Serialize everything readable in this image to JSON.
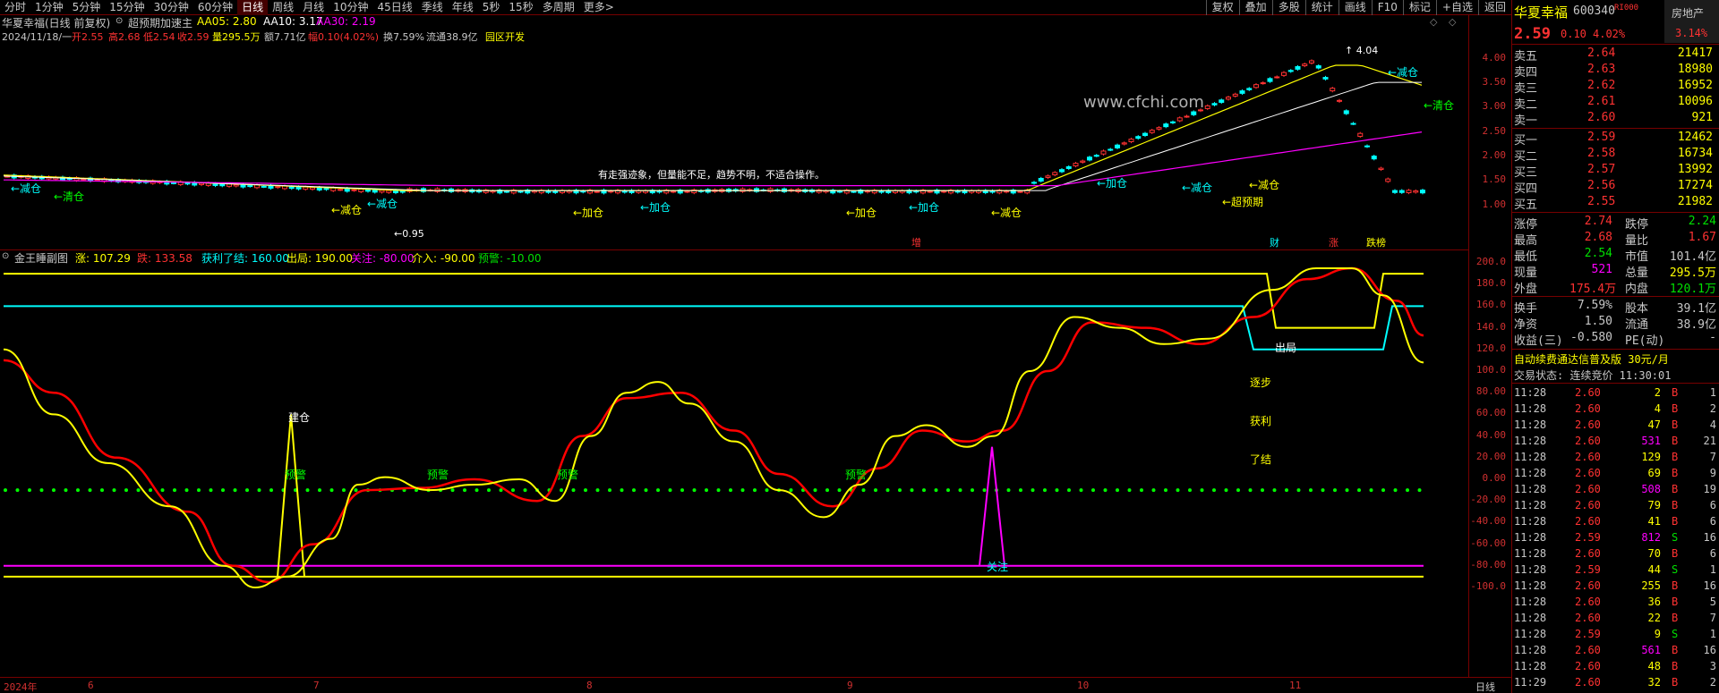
{
  "periods": [
    {
      "label": "分时",
      "active": false
    },
    {
      "label": "1分钟",
      "active": false
    },
    {
      "label": "5分钟",
      "active": false
    },
    {
      "label": "15分钟",
      "active": false
    },
    {
      "label": "30分钟",
      "active": false
    },
    {
      "label": "60分钟",
      "active": false
    },
    {
      "label": "日线",
      "active": true
    },
    {
      "label": "周线",
      "active": false
    },
    {
      "label": "月线",
      "active": false
    },
    {
      "label": "10分钟",
      "active": false
    },
    {
      "label": "45日线",
      "active": false
    },
    {
      "label": "季线",
      "active": false
    },
    {
      "label": "年线",
      "active": false
    },
    {
      "label": "5秒",
      "active": false
    },
    {
      "label": "15秒",
      "active": false
    },
    {
      "label": "多周期",
      "active": false
    },
    {
      "label": "更多>",
      "active": false
    }
  ],
  "functions": [
    "复权",
    "叠加",
    "多股",
    "统计",
    "画线",
    "F10",
    "标记",
    "+自选",
    "返回"
  ],
  "header": {
    "stock_title": "华夏幸福(日线 前复权)",
    "indicator_name": "超预期加速主",
    "aa05": "AA05: 2.80",
    "aa10": "AA10: 3.17",
    "aa30": "AA30: 2.19",
    "date": "2024/11/18/一",
    "open": "开2.55",
    "high": "高2.68",
    "low": "低2.54",
    "close": "收2.59",
    "volume": "量295.5万",
    "amount": "额7.71亿",
    "change": "幅0.10(4.02%)",
    "turnover": "换7.59%",
    "float_cap": "流通38.9亿",
    "concept": "园区开发"
  },
  "watermark": "www.cfchi.com",
  "note": "有走强迹象，但量能不足，趋势不明，不适合操作。",
  "price_labels": {
    "high_mark": "4.04",
    "low_mark": "0.95",
    "signals": [
      "减仓",
      "清仓",
      "减仓",
      "减仓",
      "加仓",
      "加仓",
      "加仓",
      "加仓",
      "减仓",
      "加仓",
      "超预期",
      "减仓",
      "减仓",
      "清仓",
      "减仓"
    ],
    "events": [
      "增",
      "财",
      "涨",
      "跌榜"
    ]
  },
  "sub_header": {
    "name": "金王睡副图",
    "up": "涨: 107.29",
    "down": "跌: 133.58",
    "profit_exit": "获利了结: 160.00",
    "out": "出局: 190.00",
    "watch": "关注: -80.00",
    "enter": "介入: -90.00",
    "warn": "预警: -10.00"
  },
  "sub_labels": {
    "build": "建仓",
    "warn": "预警",
    "watch": "关注",
    "out": "出局",
    "step1": "逐步",
    "step2": "获利",
    "step3": "了结"
  },
  "y_axis_main": [
    "4.00",
    "3.50",
    "3.00",
    "2.50",
    "2.00",
    "1.50",
    "1.00"
  ],
  "y_axis_sub": [
    "200.0",
    "180.0",
    "160.0",
    "140.0",
    "120.0",
    "100.0",
    "80.00",
    "60.00",
    "40.00",
    "20.00",
    "0.00",
    "-20.00",
    "-40.00",
    "-60.00",
    "-80.00",
    "-100.0"
  ],
  "date_axis": [
    "2024年",
    "6",
    "7",
    "8",
    "9",
    "10",
    "11"
  ],
  "period_label": "日线",
  "panel": {
    "name": "华夏幸福",
    "code": "600340",
    "badge": "RI000",
    "sector": "房地产",
    "price": "2.59",
    "chg": "0.10",
    "pct": "4.02%",
    "sector_pct": "3.14%",
    "asks": [
      {
        "label": "卖五",
        "price": "2.64",
        "vol": "21417"
      },
      {
        "label": "卖四",
        "price": "2.63",
        "vol": "18980"
      },
      {
        "label": "卖三",
        "price": "2.62",
        "vol": "16952"
      },
      {
        "label": "卖二",
        "price": "2.61",
        "vol": "10096"
      },
      {
        "label": "卖一",
        "price": "2.60",
        "vol": "921"
      }
    ],
    "bids": [
      {
        "label": "买一",
        "price": "2.59",
        "vol": "12462"
      },
      {
        "label": "买二",
        "price": "2.58",
        "vol": "16734"
      },
      {
        "label": "买三",
        "price": "2.57",
        "vol": "13992"
      },
      {
        "label": "买四",
        "price": "2.56",
        "vol": "17274"
      },
      {
        "label": "买五",
        "price": "2.55",
        "vol": "21982"
      }
    ],
    "stats": [
      {
        "l1": "涨停",
        "v1": "2.74",
        "l2": "跌停",
        "v2": "2.24"
      },
      {
        "l1": "最高",
        "v1": "2.68",
        "l2": "量比",
        "v2": "1.67"
      },
      {
        "l1": "最低",
        "v1": "2.54",
        "l2": "市值",
        "v2": "101.4亿"
      },
      {
        "l1": "现量",
        "v1": "521",
        "l2": "总量",
        "v2": "295.5万"
      },
      {
        "l1": "外盘",
        "v1": "175.4万",
        "l2": "内盘",
        "v2": "120.1万"
      }
    ],
    "stats2": [
      {
        "l1": "换手",
        "v1": "7.59%",
        "l2": "股本",
        "v2": "39.1亿"
      },
      {
        "l1": "净资",
        "v1": "1.50",
        "l2": "流通",
        "v2": "38.9亿"
      },
      {
        "l1": "收益(三)",
        "v1": "-0.580",
        "l2": "PE(动)",
        "v2": "-"
      }
    ],
    "ad": "自动续费通达信普及版  30元/月",
    "trade_status": "交易状态: 连续竞价 11:30:01",
    "ticks": [
      {
        "t": "11:28",
        "p": "2.60",
        "v": "2",
        "bs": "B",
        "n": "1"
      },
      {
        "t": "11:28",
        "p": "2.60",
        "v": "4",
        "bs": "B",
        "n": "2"
      },
      {
        "t": "11:28",
        "p": "2.60",
        "v": "47",
        "bs": "B",
        "n": "4"
      },
      {
        "t": "11:28",
        "p": "2.60",
        "v": "531",
        "bs": "B",
        "n": "21"
      },
      {
        "t": "11:28",
        "p": "2.60",
        "v": "129",
        "bs": "B",
        "n": "7"
      },
      {
        "t": "11:28",
        "p": "2.60",
        "v": "69",
        "bs": "B",
        "n": "9"
      },
      {
        "t": "11:28",
        "p": "2.60",
        "v": "508",
        "bs": "B",
        "n": "19"
      },
      {
        "t": "11:28",
        "p": "2.60",
        "v": "79",
        "bs": "B",
        "n": "6"
      },
      {
        "t": "11:28",
        "p": "2.60",
        "v": "41",
        "bs": "B",
        "n": "6"
      },
      {
        "t": "11:28",
        "p": "2.59",
        "v": "812",
        "bs": "S",
        "n": "16"
      },
      {
        "t": "11:28",
        "p": "2.60",
        "v": "70",
        "bs": "B",
        "n": "6"
      },
      {
        "t": "11:28",
        "p": "2.59",
        "v": "44",
        "bs": "S",
        "n": "1"
      },
      {
        "t": "11:28",
        "p": "2.60",
        "v": "255",
        "bs": "B",
        "n": "16"
      },
      {
        "t": "11:28",
        "p": "2.60",
        "v": "36",
        "bs": "B",
        "n": "5"
      },
      {
        "t": "11:28",
        "p": "2.60",
        "v": "22",
        "bs": "B",
        "n": "7"
      },
      {
        "t": "11:28",
        "p": "2.59",
        "v": "9",
        "bs": "S",
        "n": "1"
      },
      {
        "t": "11:28",
        "p": "2.60",
        "v": "561",
        "bs": "B",
        "n": "16"
      },
      {
        "t": "11:28",
        "p": "2.60",
        "v": "48",
        "bs": "B",
        "n": "3"
      },
      {
        "t": "11:29",
        "p": "2.60",
        "v": "32",
        "bs": "B",
        "n": "2"
      }
    ]
  },
  "colors": {
    "up": "#ff3232",
    "down": "#00e000",
    "yellow": "#ffff00",
    "cyan": "#00ffff",
    "magenta": "#ff00ff",
    "axis": "#d03030"
  }
}
